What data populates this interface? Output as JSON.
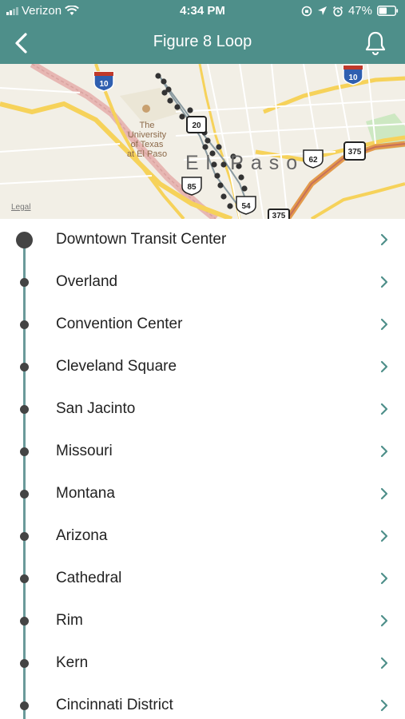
{
  "status": {
    "carrier": "Verizon",
    "time": "4:34 PM",
    "battery": "47%"
  },
  "nav": {
    "title": "Figure 8 Loop"
  },
  "map": {
    "city_label": "El Paso",
    "university_label_line1": "The",
    "university_label_line2": "University",
    "university_label_line3": "of Texas",
    "university_label_line4": "at El Paso",
    "legal": "Legal",
    "shields": [
      "10",
      "10",
      "20",
      "62",
      "375",
      "85",
      "375",
      "54"
    ]
  },
  "stops": [
    {
      "name": "Downtown Transit Center"
    },
    {
      "name": "Overland"
    },
    {
      "name": "Convention Center"
    },
    {
      "name": "Cleveland Square"
    },
    {
      "name": "San Jacinto"
    },
    {
      "name": "Missouri"
    },
    {
      "name": "Montana"
    },
    {
      "name": "Arizona"
    },
    {
      "name": "Cathedral"
    },
    {
      "name": "Rim"
    },
    {
      "name": "Kern"
    },
    {
      "name": "Cincinnati District"
    }
  ],
  "colors": {
    "header": "#4e8f8a",
    "timeline": "#6a9a9a",
    "chevron": "#4e8f8a"
  }
}
